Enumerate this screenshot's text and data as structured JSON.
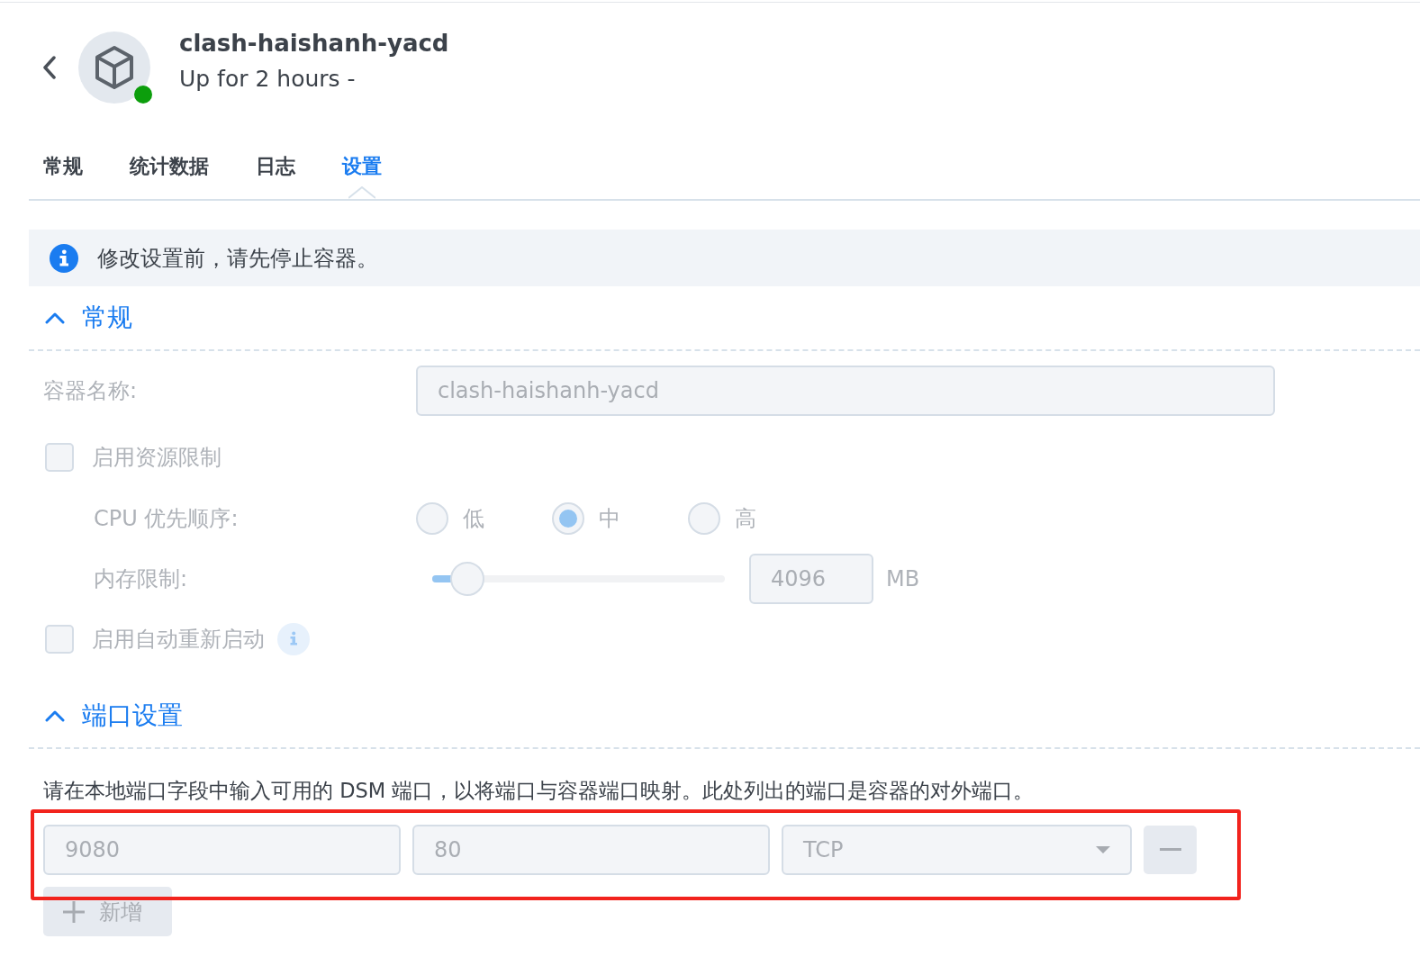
{
  "header": {
    "title": "clash-haishanh-yacd",
    "status": "Up for 2 hours -",
    "running": true
  },
  "tabs": [
    {
      "label": "常规",
      "selected": false
    },
    {
      "label": "统计数据",
      "selected": false
    },
    {
      "label": "日志",
      "selected": false
    },
    {
      "label": "设置",
      "selected": true
    }
  ],
  "notice": "修改设置前，请先停止容器。",
  "general_section": {
    "title": "常规",
    "expanded": true,
    "disabled": true,
    "container_name": {
      "label": "容器名称:",
      "value": "clash-haishanh-yacd"
    },
    "resource_limit": {
      "label": "启用资源限制",
      "checked": false
    },
    "cpu_priority": {
      "label": "CPU 优先顺序:",
      "options": [
        {
          "label": "低",
          "selected": false
        },
        {
          "label": "中",
          "selected": true
        },
        {
          "label": "高",
          "selected": false
        }
      ]
    },
    "memory_limit": {
      "label": "内存限制:",
      "level": 0.12,
      "value": "4096",
      "unit": "MB"
    },
    "auto_restart": {
      "label": "启用自动重新启动",
      "checked": false
    }
  },
  "port_section": {
    "title": "端口设置",
    "expanded": true,
    "disabled": true,
    "description": "请在本地端口字段中输入可用的 DSM 端口，以将端口与容器端口映射。此处列出的端口是容器的对外端口。",
    "ports": [
      {
        "local_port": "9080",
        "container_port": "80",
        "protocol": "TCP"
      }
    ],
    "add_button": "新增"
  }
}
